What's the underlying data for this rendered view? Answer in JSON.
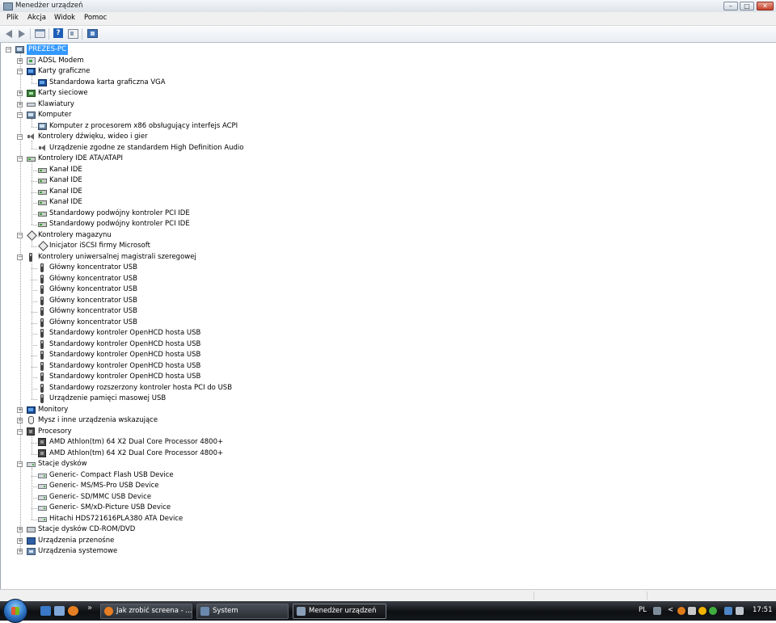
{
  "window": {
    "title": "Menedżer urządzeń",
    "controls": {
      "minimize": "–",
      "maximize": "□",
      "close": "✕"
    }
  },
  "menu": [
    "Plik",
    "Akcja",
    "Widok",
    "Pomoc"
  ],
  "toolbar": {
    "buttons": [
      "back-arrow-icon",
      "forward-arrow-icon",
      "console-tree-icon",
      "help-icon",
      "properties-icon",
      "scan-hardware-icon"
    ]
  },
  "tree": {
    "root": "PREZES-PC",
    "categories": [
      {
        "label": "ADSL Modem",
        "icon": "modem-icon",
        "expanded": false,
        "children": []
      },
      {
        "label": "Karty graficzne",
        "icon": "display-adapter-icon",
        "expanded": true,
        "children": [
          {
            "label": "Standardowa karta graficzna VGA",
            "icon": "display-adapter-icon"
          }
        ]
      },
      {
        "label": "Karty sieciowe",
        "icon": "network-adapter-icon",
        "expanded": false,
        "children": []
      },
      {
        "label": "Klawiatury",
        "icon": "keyboard-icon",
        "expanded": false,
        "children": []
      },
      {
        "label": "Komputer",
        "icon": "computer-icon",
        "expanded": true,
        "children": [
          {
            "label": "Komputer z procesorem x86 obsługujący interfejs ACPI",
            "icon": "computer-icon"
          }
        ]
      },
      {
        "label": "Kontrolery dźwięku, wideo i gier",
        "icon": "speaker-icon",
        "expanded": true,
        "children": [
          {
            "label": "Urządzenie zgodne ze standardem High Definition Audio",
            "icon": "speaker-icon"
          }
        ]
      },
      {
        "label": "Kontrolery IDE ATA/ATAPI",
        "icon": "ide-controller-icon",
        "expanded": true,
        "children": [
          {
            "label": "Kanał IDE",
            "icon": "ide-controller-icon"
          },
          {
            "label": "Kanał IDE",
            "icon": "ide-controller-icon"
          },
          {
            "label": "Kanał IDE",
            "icon": "ide-controller-icon"
          },
          {
            "label": "Kanał IDE",
            "icon": "ide-controller-icon"
          },
          {
            "label": "Standardowy podwójny kontroler PCI IDE",
            "icon": "ide-controller-icon"
          },
          {
            "label": "Standardowy podwójny kontroler PCI IDE",
            "icon": "ide-controller-icon"
          }
        ]
      },
      {
        "label": "Kontrolery magazynu",
        "icon": "storage-controller-icon",
        "expanded": true,
        "children": [
          {
            "label": "Inicjator iSCSI firmy Microsoft",
            "icon": "storage-controller-icon"
          }
        ]
      },
      {
        "label": "Kontrolery uniwersalnej magistrali szeregowej",
        "icon": "usb-icon",
        "expanded": true,
        "children": [
          {
            "label": "Główny koncentrator USB",
            "icon": "usb-icon"
          },
          {
            "label": "Główny koncentrator USB",
            "icon": "usb-icon"
          },
          {
            "label": "Główny koncentrator USB",
            "icon": "usb-icon"
          },
          {
            "label": "Główny koncentrator USB",
            "icon": "usb-icon"
          },
          {
            "label": "Główny koncentrator USB",
            "icon": "usb-icon"
          },
          {
            "label": "Główny koncentrator USB",
            "icon": "usb-icon"
          },
          {
            "label": "Standardowy kontroler OpenHCD hosta USB",
            "icon": "usb-icon"
          },
          {
            "label": "Standardowy kontroler OpenHCD hosta USB",
            "icon": "usb-icon"
          },
          {
            "label": "Standardowy kontroler OpenHCD hosta USB",
            "icon": "usb-icon"
          },
          {
            "label": "Standardowy kontroler OpenHCD hosta USB",
            "icon": "usb-icon"
          },
          {
            "label": "Standardowy kontroler OpenHCD hosta USB",
            "icon": "usb-icon"
          },
          {
            "label": "Standardowy rozszerzony kontroler hosta PCI do USB",
            "icon": "usb-icon"
          },
          {
            "label": "Urządzenie pamięci masowej USB",
            "icon": "usb-icon"
          }
        ]
      },
      {
        "label": "Monitory",
        "icon": "monitor-icon",
        "expanded": false,
        "children": []
      },
      {
        "label": "Mysz i inne urządzenia wskazujące",
        "icon": "mouse-icon",
        "expanded": false,
        "children": []
      },
      {
        "label": "Procesory",
        "icon": "processor-icon",
        "expanded": true,
        "children": [
          {
            "label": "AMD Athlon(tm) 64 X2 Dual Core Processor 4800+",
            "icon": "processor-icon"
          },
          {
            "label": "AMD Athlon(tm) 64 X2 Dual Core Processor 4800+",
            "icon": "processor-icon"
          }
        ]
      },
      {
        "label": "Stacje dysków",
        "icon": "disk-drive-icon",
        "expanded": true,
        "children": [
          {
            "label": "Generic- Compact Flash USB Device",
            "icon": "disk-drive-icon"
          },
          {
            "label": "Generic- MS/MS-Pro USB Device",
            "icon": "disk-drive-icon"
          },
          {
            "label": "Generic- SD/MMC USB Device",
            "icon": "disk-drive-icon"
          },
          {
            "label": "Generic- SM/xD-Picture USB Device",
            "icon": "disk-drive-icon"
          },
          {
            "label": "Hitachi HDS721616PLA380 ATA Device",
            "icon": "disk-drive-icon"
          }
        ]
      },
      {
        "label": "Stacje dysków CD-ROM/DVD",
        "icon": "cdrom-icon",
        "expanded": false,
        "children": []
      },
      {
        "label": "Urządzenia przenośne",
        "icon": "portable-device-icon",
        "expanded": false,
        "children": []
      },
      {
        "label": "Urządzenia systemowe",
        "icon": "system-device-icon",
        "expanded": false,
        "children": []
      }
    ]
  },
  "taskbar": {
    "tasks": [
      {
        "label": "Jak zrobić screena - ...",
        "icon": "firefox-icon",
        "active": false
      },
      {
        "label": "System",
        "icon": "system-window-icon",
        "active": false
      },
      {
        "label": "Menedżer urządzeń",
        "icon": "device-manager-icon",
        "active": true
      }
    ],
    "tray": {
      "language": "PL",
      "clock": "17:51"
    }
  },
  "colors": {
    "selection": "#3399ff",
    "taskbar": "#15181c"
  }
}
